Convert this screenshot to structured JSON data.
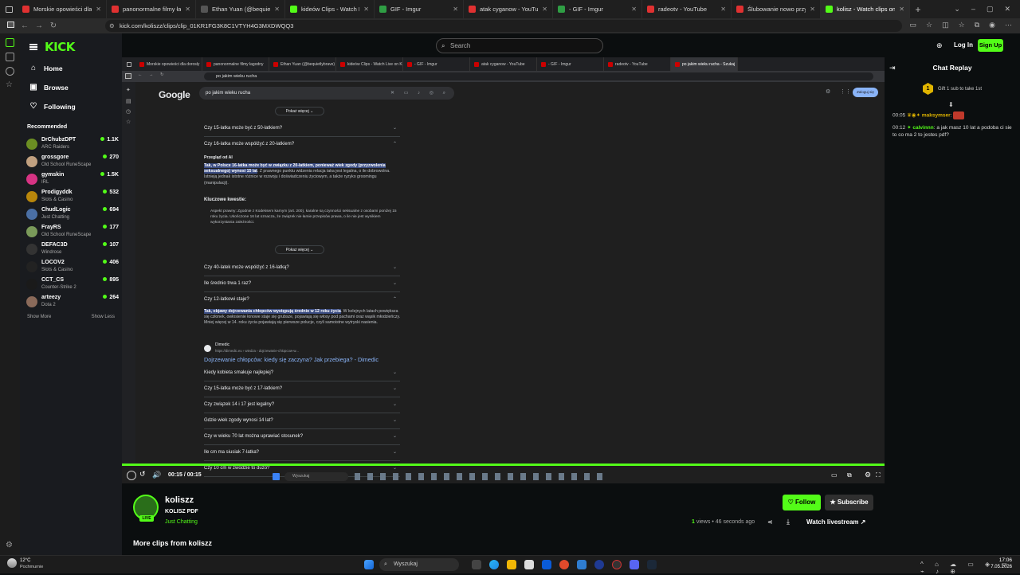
{
  "browser": {
    "tabs": [
      {
        "label": "Morskie opowieści dla dorosły",
        "color": "#e03131"
      },
      {
        "label": "panonormalne filmy łagodny",
        "color": "#e03131"
      },
      {
        "label": "Ethan Yuan (@bequietlybrave) |",
        "color": "#555555"
      },
      {
        "label": "kideów Clips - Watch Live on Ki",
        "color": "#53fc18"
      },
      {
        "label": "GIF - Imgur",
        "color": "#2f9e44"
      },
      {
        "label": "atak cyganow - YouTube",
        "color": "#e03131"
      },
      {
        "label": "- GIF - Imgur",
        "color": "#2f9e44"
      },
      {
        "label": "radeotv - YouTube",
        "color": "#e03131"
      },
      {
        "label": "Ślubowanie nowo przyjętych p",
        "color": "#e03131"
      },
      {
        "label": "kolisz - Watch clips on Kick",
        "color": "#53fc18"
      }
    ],
    "url": "kick.com/koliszz/clips/clip_01KR1FG3K8C1VTYH4G3MXDWQQ3"
  },
  "kick": {
    "logo": "KICK",
    "search_placeholder": "Search",
    "login": "Log In",
    "signup": "Sign Up",
    "nav": [
      {
        "label": "Home",
        "icon": "home-icon"
      },
      {
        "label": "Browse",
        "icon": "browse-icon"
      },
      {
        "label": "Following",
        "icon": "heart-icon"
      }
    ],
    "recommended_title": "Recommended",
    "recommended": [
      {
        "name": "DrChubzDPT",
        "category": "ARC Raiders",
        "viewers": "1.1K",
        "color": "#6b8e23"
      },
      {
        "name": "grossgore",
        "category": "Old School RuneScape",
        "viewers": "270",
        "color": "#c0a080"
      },
      {
        "name": "gymskin",
        "category": "IRL",
        "viewers": "1.5K",
        "color": "#d63384"
      },
      {
        "name": "Prodigyddk",
        "category": "Slots & Casino",
        "viewers": "532",
        "color": "#b8860b"
      },
      {
        "name": "ChudLogic",
        "category": "Just Chatting",
        "viewers": "694",
        "color": "#4a6fa5"
      },
      {
        "name": "FrayRS",
        "category": "Old School RuneScape",
        "viewers": "177",
        "color": "#7a9a5a"
      },
      {
        "name": "DEFAC3D",
        "category": "Windrose",
        "viewers": "107",
        "color": "#333333"
      },
      {
        "name": "LOCOV2",
        "category": "Slots & Casino",
        "viewers": "406",
        "color": "#222222"
      },
      {
        "name": "CCT_CS",
        "category": "Counter-Strike 2",
        "viewers": "895",
        "color": "#1a1a1a"
      },
      {
        "name": "arteezy",
        "category": "Dota 2",
        "viewers": "264",
        "color": "#8a6a5a"
      }
    ],
    "show_more": "Show More",
    "show_less": "Show Less"
  },
  "inner": {
    "tabs": [
      "Morskie opowieści dla dorosły",
      "panonormalne filmy łagodny",
      "Ethan Yuan (@bequietlybrave)",
      "kideów Clips - Watch Live on Ki",
      "- GIF - Imgur",
      "atak cyganow - YouTube",
      "- GIF - Imgur",
      "radeotv - YouTube",
      "po jakim wieku rucha - Szukaj"
    ],
    "address": "po jakim wieku rucha",
    "google_logo": "Google",
    "query": "po jakim wieku rucha",
    "signin": "Zaloguj się",
    "show_more_1": "Pokaż więcej",
    "q1": "Czy 15-latka może być z 50-latkiem?",
    "q2": "Czy 16-latka może współżyć z 20-latkiem?",
    "ai_overview": "Przegląd od AI",
    "ai_hl": "Tak, w Polsce 16-latka może być w związku z 20-latkiem, ponieważ wiek zgody (przyzwolenia seksualnego) wynosi 15 lat",
    "ai_rest": ". Z prawnego punktu widzenia relacja taka jest legalna, o ile dobrowolna. Istnieją jednak istotne różnice w rozwoju i doświadczeniu życiowym, a także ryzyko groomingu (manipulacji).",
    "key_issues": "Kluczowe kwestie:",
    "bullet": "Aspekt prawny: Zgodnie z Kodeksem karnym (art. 200), karalne są czynności seksualne z osobami poniżej 15 roku życia. Ukończone 16 lat oznacza, że związek nie łamie przepisów prawa, o ile nie jest wynikiem wykorzystania zależności.",
    "show_more_2": "Pokaż więcej",
    "q3": "Czy 40-latek może współżyć z 16-latką?",
    "q4": "Ile średnio trwa 1 raz?",
    "q5": "Czy 12-latkowi staje?",
    "ans_hl": "Tak, objawy dojrzewania chłopców występują średnio w 12 roku życia",
    "ans_rest": ". W kolejnych latach powiększa się członek, owłosienie łonowe staje się grubsze, pojawiają się włosy pod pachami oraz wąsik młodzieńczy. Mniej więcej w 14. roku życia pojawiają się pierwsze polucje, czyli samoistne wytryski nasienia.",
    "source_name": "Dimedic",
    "source_url": "https://dimedic.eu › wiedza › dojrzewanie-chlopcow-w...",
    "source_title": "Dojrzewanie chłopców: kiedy się zaczyna? Jak przebiega? - Dimedic",
    "more_qs": [
      "Kiedy kobieta smakuje najlepiej?",
      "Czy 15-latka może być z 17-latkiem?",
      "Czy związek 14 i 17 jest legalny?",
      "Gdzie wiek zgody wynosi 14 lat?",
      "Czy w wieku 70 lat można uprawiać stosunek?",
      "Ile cm ma siusiak 7-latka?",
      "Czy 10 cm w zwodzie to dużo?"
    ],
    "taskbar_search": "Wyszukaj"
  },
  "player": {
    "time": "00:15 / 00:15",
    "progress": 1.0
  },
  "channel": {
    "name": "koliszz",
    "title": "KOLISZ PDF",
    "category": "Just Chatting",
    "live": "LIVE",
    "follow": "Follow",
    "subscribe": "Subscribe",
    "views_count": "1",
    "views_label": "views",
    "posted": "46 seconds ago",
    "watch_livestream": "Watch livestream",
    "more_clips": "More clips from koliszz"
  },
  "chat": {
    "title": "Chat Replay",
    "gift": "Gift 1 sub to take 1st",
    "gift_badge": "1",
    "messages": [
      {
        "time": "00:05",
        "user": "maksymser",
        "user_color": "#e0b400",
        "text": ""
      },
      {
        "time": "00:12",
        "user": "calvinnn",
        "user_color": "#53fc18",
        "text": "a jak masz 10 lat a podoba ci sie to co ma 2 to jestes pdf?"
      }
    ]
  },
  "taskbar": {
    "weather_temp": "12°C",
    "weather_desc": "Pochmurnie",
    "search": "Wyszukaj",
    "time": "17:06",
    "date": "7.05.2026"
  }
}
